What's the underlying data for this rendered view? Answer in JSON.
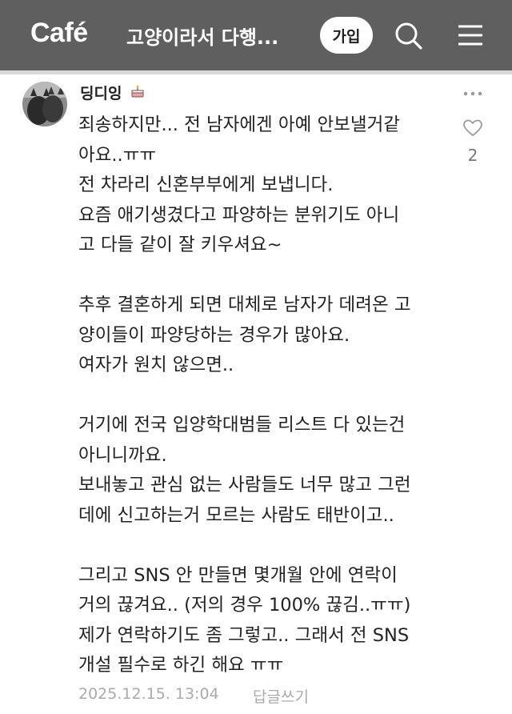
{
  "header": {
    "logo": "Café",
    "cafe_name": "고양이라서 다행...",
    "join_label": "가입",
    "icons": [
      "search-icon",
      "menu-icon"
    ]
  },
  "comment": {
    "author": "딩디잉",
    "author_badge": "cake-icon",
    "lines": [
      "죄송하지만... 전 남자에겐 아예 안보낼거같",
      "아요..ㅠㅠ",
      "전 차라리 신혼부부에게 보냅니다.",
      "요즘 애기생겼다고 파양하는 분위기도 아니",
      "고 다들 같이 잘 키우셔요~",
      "",
      "추후 결혼하게 되면 대체로 남자가 데려온 고",
      "양이들이 파양당하는 경우가 많아요.",
      "여자가 원치 않으면..",
      "",
      "거기에 전국 입양학대범들 리스트 다 있는건",
      "아니니까요.",
      "보내놓고 관심 없는 사람들도 너무 많고 그런",
      "데에 신고하는거 모르는 사람도 태반이고..",
      "",
      "그리고 SNS 안 만들면 몇개월 안에 연락이",
      "거의 끊겨요.. (저의 경우 100% 끊김..ㅠㅠ)",
      "제가 연락하기도 좀 그렇고.. 그래서 전 SNS",
      "개설 필수로 하긴 해요 ㅠㅠ"
    ],
    "like_count": "2",
    "date": "2025.12.15. 13:04",
    "reply_label": "답글쓰기"
  },
  "colors": {
    "header_bg": "#5f5f5f",
    "meta_text": "#aaaaaa",
    "body_text": "#222222"
  }
}
